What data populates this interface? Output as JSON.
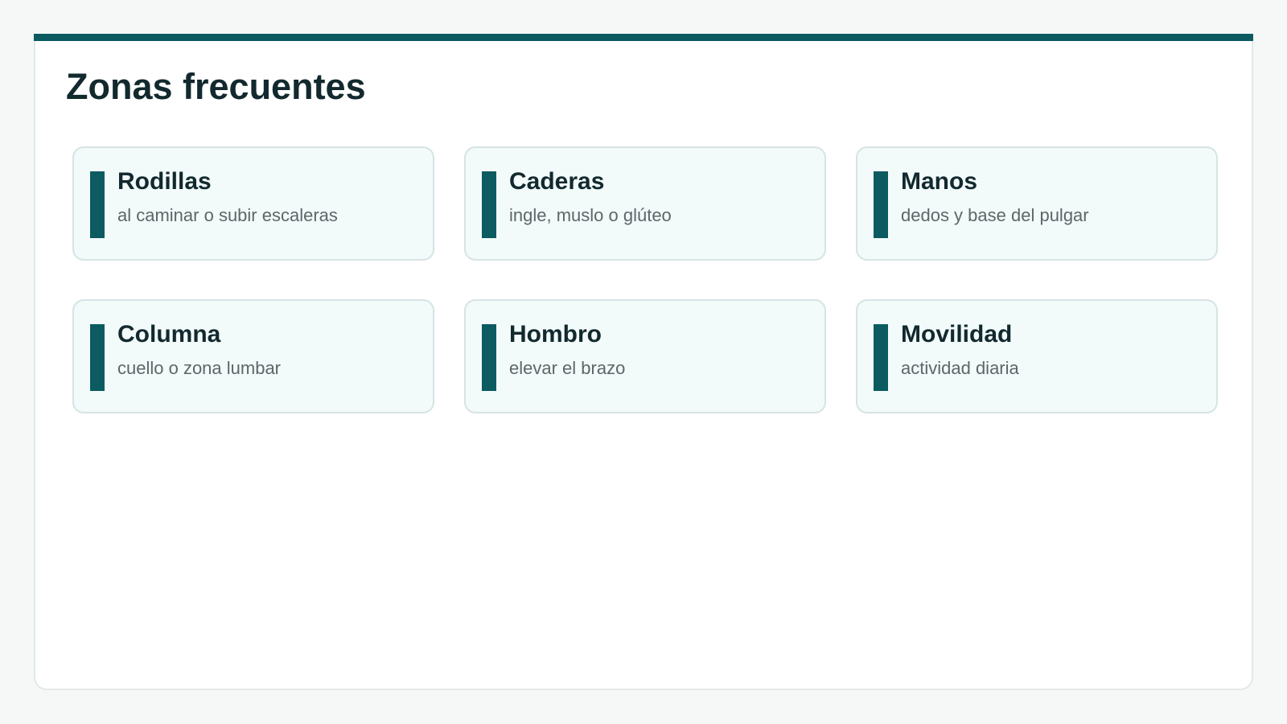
{
  "page": {
    "title": "Zonas frecuentes"
  },
  "zones": [
    {
      "name": "Rodillas",
      "description": "al caminar o subir escaleras"
    },
    {
      "name": "Caderas",
      "description": "ingle, muslo o glúteo"
    },
    {
      "name": "Manos",
      "description": "dedos y base del pulgar"
    },
    {
      "name": "Columna",
      "description": "cuello o zona lumbar"
    },
    {
      "name": "Hombro",
      "description": "elevar el brazo"
    },
    {
      "name": "Movilidad",
      "description": "actividad diaria"
    }
  ],
  "colors": {
    "accent": "#0b5b61",
    "card_background": "#f2fafa",
    "title_text": "#12292e",
    "description_text": "#5d6668"
  }
}
